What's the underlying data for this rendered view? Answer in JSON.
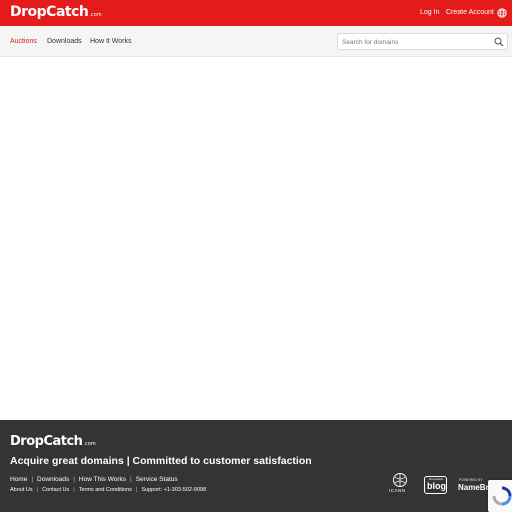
{
  "header": {
    "logo": "DropCatch",
    "logo_suffix": ".com",
    "login_label": "Log In",
    "create_account_label": "Create Account",
    "language_icon": "globe-icon"
  },
  "nav": {
    "items": [
      {
        "label": "Auctions",
        "active": true
      },
      {
        "label": "Downloads",
        "active": false
      },
      {
        "label": "How It Works",
        "active": false
      }
    ]
  },
  "search": {
    "placeholder": "Search for domains",
    "value": "",
    "icon": "search-icon"
  },
  "footer": {
    "logo": "DropCatch",
    "logo_suffix": ".com",
    "tagline": "Acquire great domains | Committed to customer satisfaction",
    "links_row1": [
      "Home",
      "Downloads",
      "How This Works",
      "Service Status"
    ],
    "links_row2": [
      "About Us",
      "Contact Us",
      "Terms and Conditions",
      "Support: +1-303-502-9098"
    ],
    "icann_label": "ICANN",
    "blog_small": "DropCatch",
    "blog_label": "blog",
    "powered_by": "POWERED BY",
    "namebright": "NameBright"
  },
  "colors": {
    "brand_red": "#e31b1b",
    "footer_bg": "#343434",
    "nav_bg": "#f5f5f5"
  }
}
